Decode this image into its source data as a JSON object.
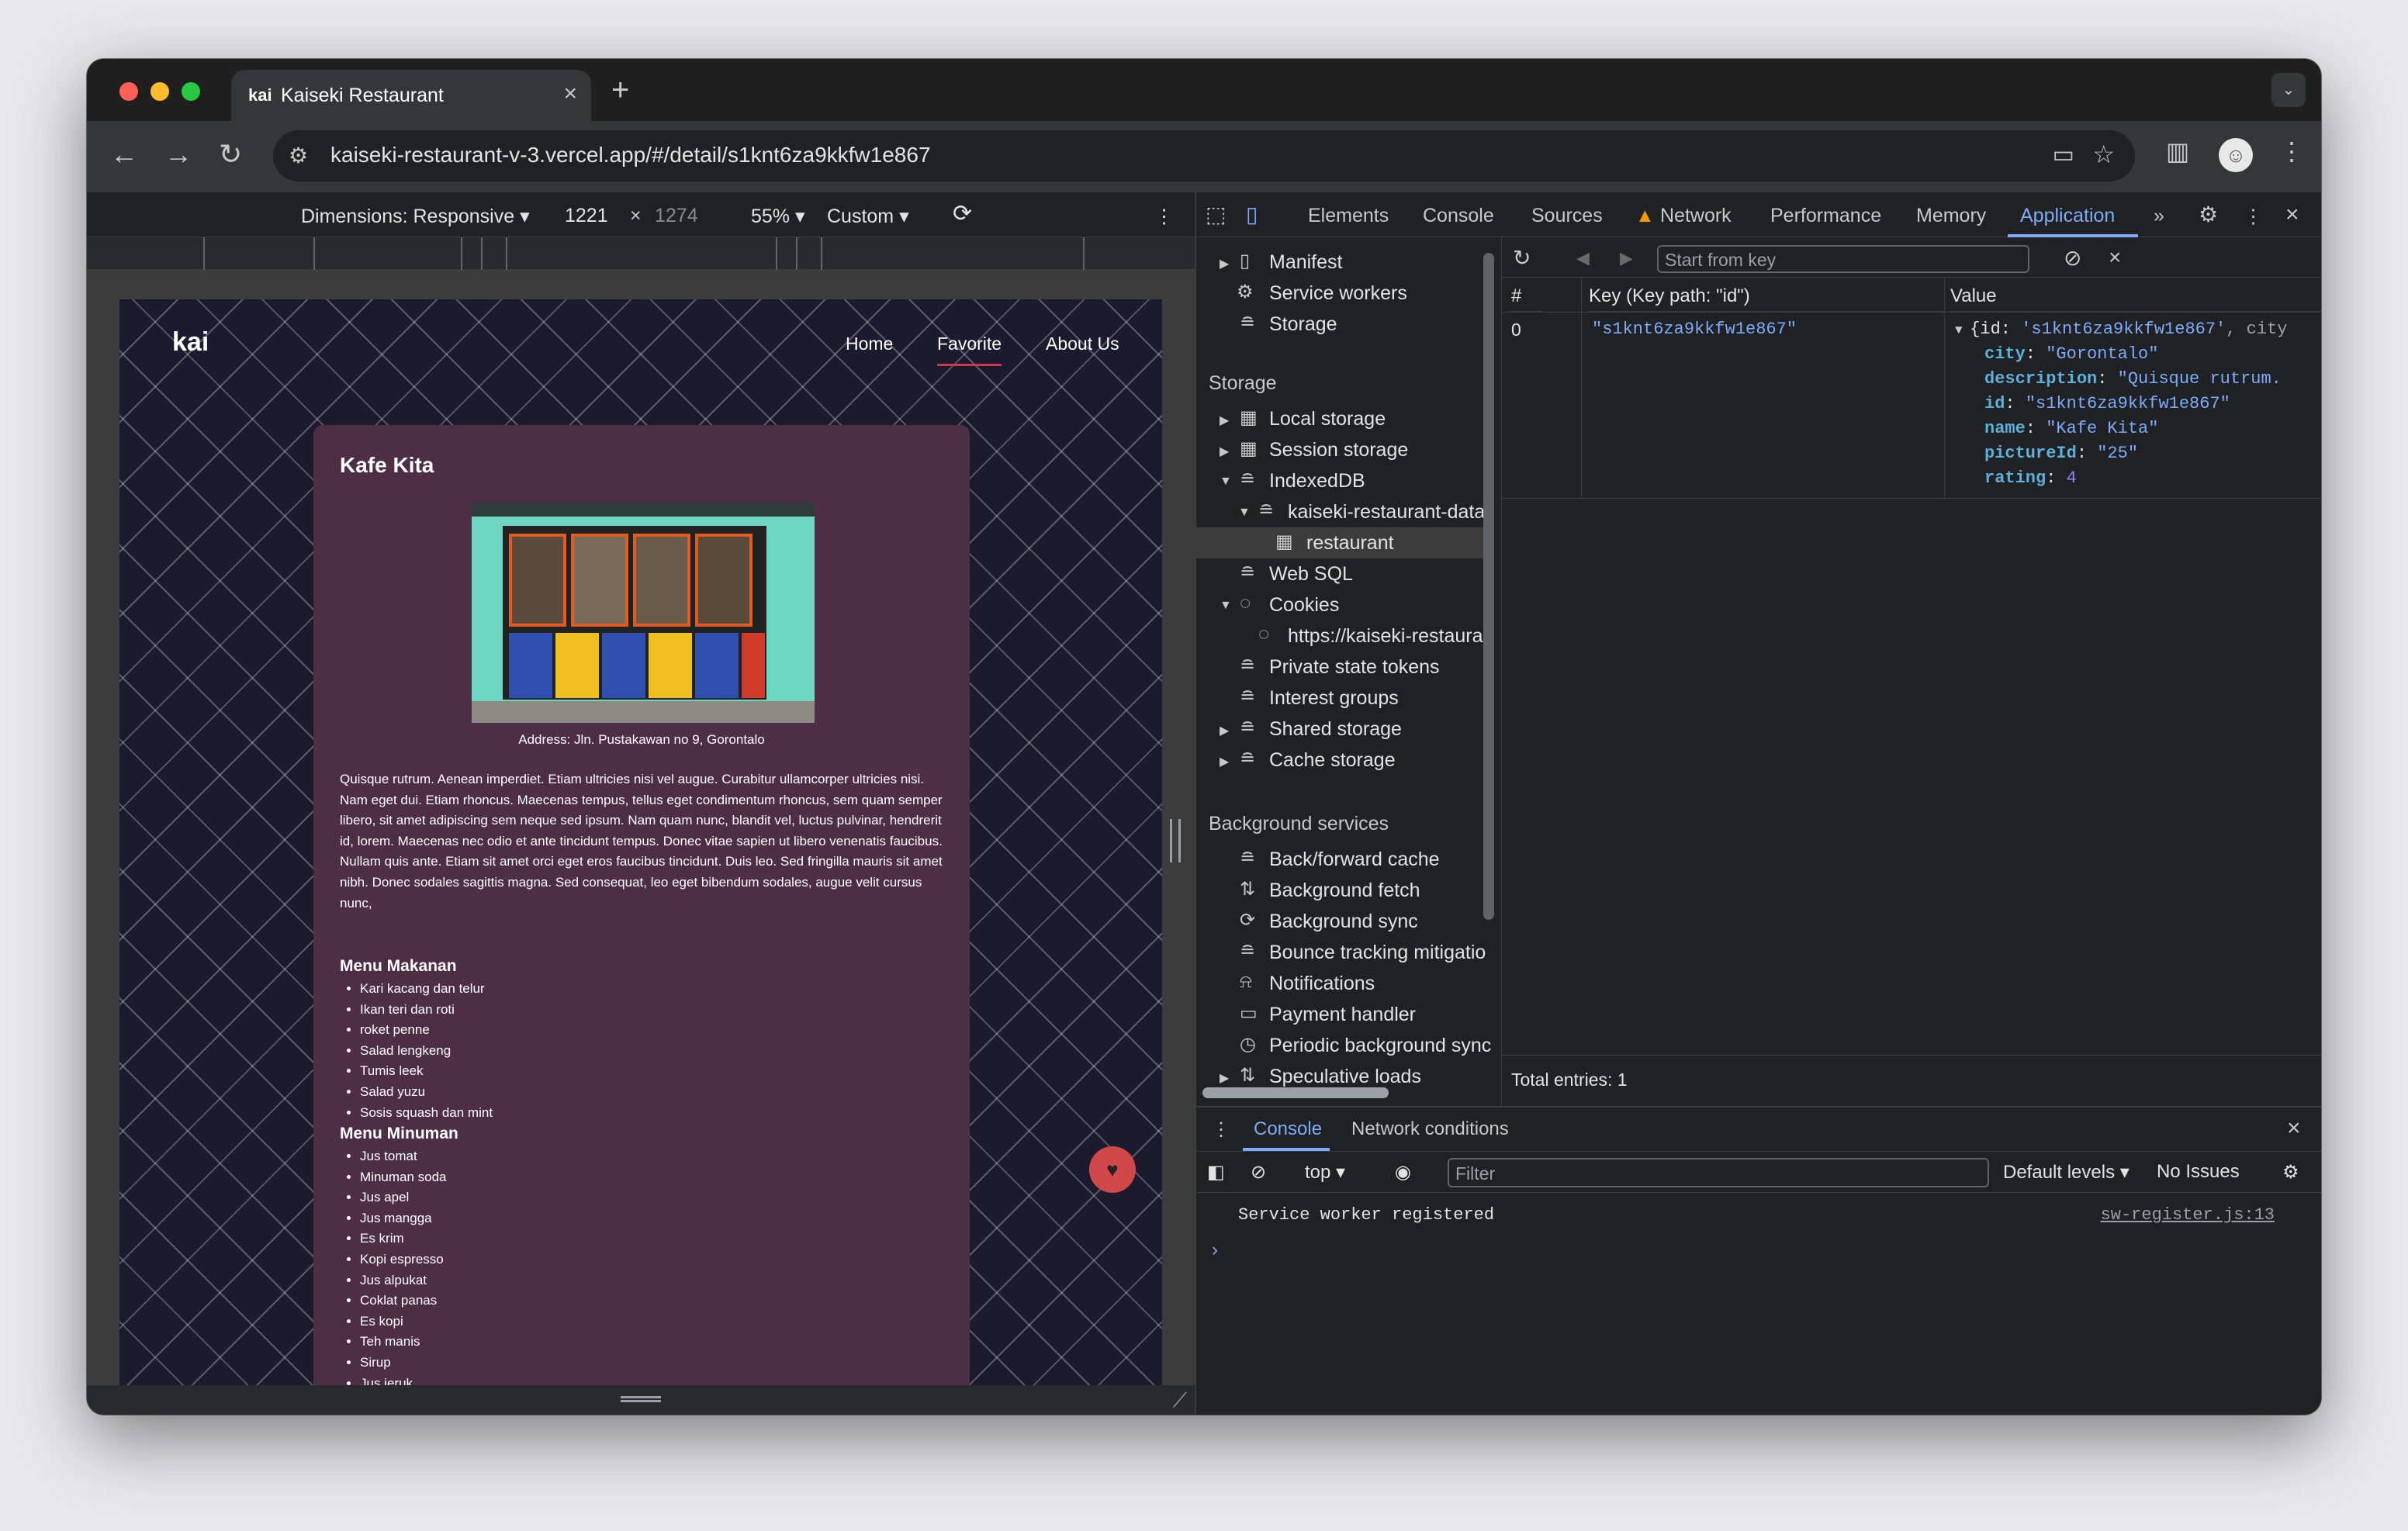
{
  "browser": {
    "tab_favicon": "kai",
    "tab_title": "Kaiseki Restaurant",
    "url": "kaiseki-restaurant-v-3.vercel.app/#/detail/s1knt6za9kkfw1e867"
  },
  "device_toolbar": {
    "dimensions_label": "Dimensions: Responsive",
    "width": "1221",
    "times": "×",
    "height": "1274",
    "zoom": "55%",
    "throttle": "Custom"
  },
  "site": {
    "logo": "kai",
    "nav": [
      "Home",
      "Favorite",
      "About Us"
    ],
    "restaurant_name": "Kafe Kita",
    "address": "Address: Jln. Pustakawan no 9, Gorontalo",
    "description": "Quisque rutrum. Aenean imperdiet. Etiam ultricies nisi vel augue. Curabitur ullamcorper ultricies nisi. Nam eget dui. Etiam rhoncus. Maecenas tempus, tellus eget condimentum rhoncus, sem quam semper libero, sit amet adipiscing sem neque sed ipsum. Nam quam nunc, blandit vel, luctus pulvinar, hendrerit id, lorem. Maecenas nec odio et ante tincidunt tempus. Donec vitae sapien ut libero venenatis faucibus. Nullam quis ante. Etiam sit amet orci eget eros faucibus tincidunt. Duis leo. Sed fringilla mauris sit amet nibh. Donec sodales sagittis magna. Sed consequat, leo eget bibendum sodales, augue velit cursus nunc,",
    "food_heading": "Menu Makanan",
    "foods": [
      "Kari kacang dan telur",
      "Ikan teri dan roti",
      "roket penne",
      "Salad lengkeng",
      "Tumis leek",
      "Salad yuzu",
      "Sosis squash dan mint"
    ],
    "drink_heading": "Menu Minuman",
    "drinks": [
      "Jus tomat",
      "Minuman soda",
      "Jus apel",
      "Jus mangga",
      "Es krim",
      "Kopi espresso",
      "Jus alpukat",
      "Coklat panas",
      "Es kopi",
      "Teh manis",
      "Sirup",
      "Jus jeruk"
    ],
    "favorite_icon": "heart-icon"
  },
  "devtools": {
    "tabs": [
      "Elements",
      "Console",
      "Sources",
      "Network",
      "Performance",
      "Memory",
      "Application"
    ],
    "selected_tab": "Application",
    "sidebar": {
      "application_items": [
        "Manifest",
        "Service workers",
        "Storage"
      ],
      "storage_heading": "Storage",
      "storage_items": [
        "Local storage",
        "Session storage",
        "IndexedDB",
        "kaiseki-restaurant-data",
        "restaurant",
        "Web SQL",
        "Cookies",
        "https://kaiseki-restaura",
        "Private state tokens",
        "Interest groups",
        "Shared storage",
        "Cache storage"
      ],
      "bg_heading": "Background services",
      "bg_items": [
        "Back/forward cache",
        "Background fetch",
        "Background sync",
        "Bounce tracking mitigatio",
        "Notifications",
        "Payment handler",
        "Periodic background sync",
        "Speculative loads"
      ]
    },
    "key_filter_placeholder": "Start from key",
    "table": {
      "col_index": "#",
      "col_key": "Key (Key path: \"id\")",
      "col_value": "Value",
      "row_index": "0",
      "row_key": "\"s1knt6za9kkfw1e867\"",
      "value_summary_open": "{id: ",
      "value_summary_id": "'s1knt6za9kkfw1e867'",
      "value_summary_rest": ", city",
      "props": [
        {
          "k": "city",
          "v": "\"Gorontalo\"",
          "t": "str"
        },
        {
          "k": "description",
          "v": "\"Quisque rutrum.",
          "t": "str"
        },
        {
          "k": "id",
          "v": "\"s1knt6za9kkfw1e867\"",
          "t": "str"
        },
        {
          "k": "name",
          "v": "\"Kafe Kita\"",
          "t": "str"
        },
        {
          "k": "pictureId",
          "v": "\"25\"",
          "t": "str"
        },
        {
          "k": "rating",
          "v": "4",
          "t": "num"
        }
      ]
    },
    "total_entries": "Total entries: 1",
    "drawer": {
      "tabs": [
        "Console",
        "Network conditions"
      ],
      "context": "top",
      "filter_placeholder": "Filter",
      "levels": "Default levels",
      "issues": "No Issues",
      "log_message": "Service worker registered",
      "log_source": "sw-register.js:13"
    }
  }
}
